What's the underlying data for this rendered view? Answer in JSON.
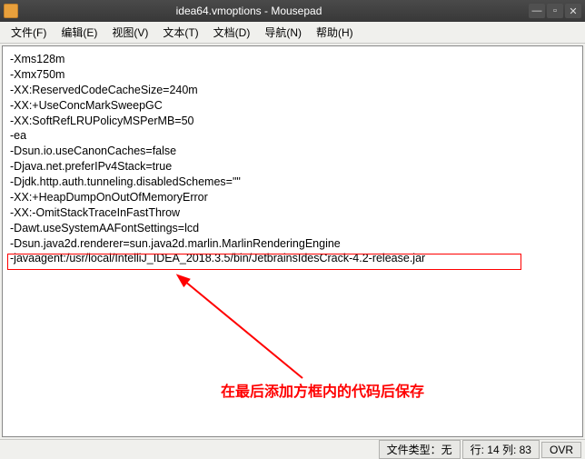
{
  "window": {
    "title": "idea64.vmoptions - Mousepad"
  },
  "menu": {
    "file": "文件(F)",
    "edit": "编辑(E)",
    "view": "视图(V)",
    "text": "文本(T)",
    "document": "文档(D)",
    "navigate": "导航(N)",
    "help": "帮助(H)"
  },
  "content": {
    "lines": [
      "-Xms128m",
      "-Xmx750m",
      "-XX:ReservedCodeCacheSize=240m",
      "-XX:+UseConcMarkSweepGC",
      "-XX:SoftRefLRUPolicyMSPerMB=50",
      "-ea",
      "-Dsun.io.useCanonCaches=false",
      "-Djava.net.preferIPv4Stack=true",
      "-Djdk.http.auth.tunneling.disabledSchemes=\"\"",
      "-XX:+HeapDumpOnOutOfMemoryError",
      "-XX:-OmitStackTraceInFastThrow",
      "-Dawt.useSystemAAFontSettings=lcd",
      "-Dsun.java2d.renderer=sun.java2d.marlin.MarlinRenderingEngine",
      "-javaagent:/usr/local/IntelliJ_IDEA_2018.3.5/bin/JetbrainsIdesCrack-4.2-release.jar"
    ]
  },
  "annotation": {
    "text": "在最后添加方框内的代码后保存"
  },
  "status": {
    "filetype": "文件类型：无",
    "position": "行: 14 列: 83",
    "mode": "OVR"
  }
}
